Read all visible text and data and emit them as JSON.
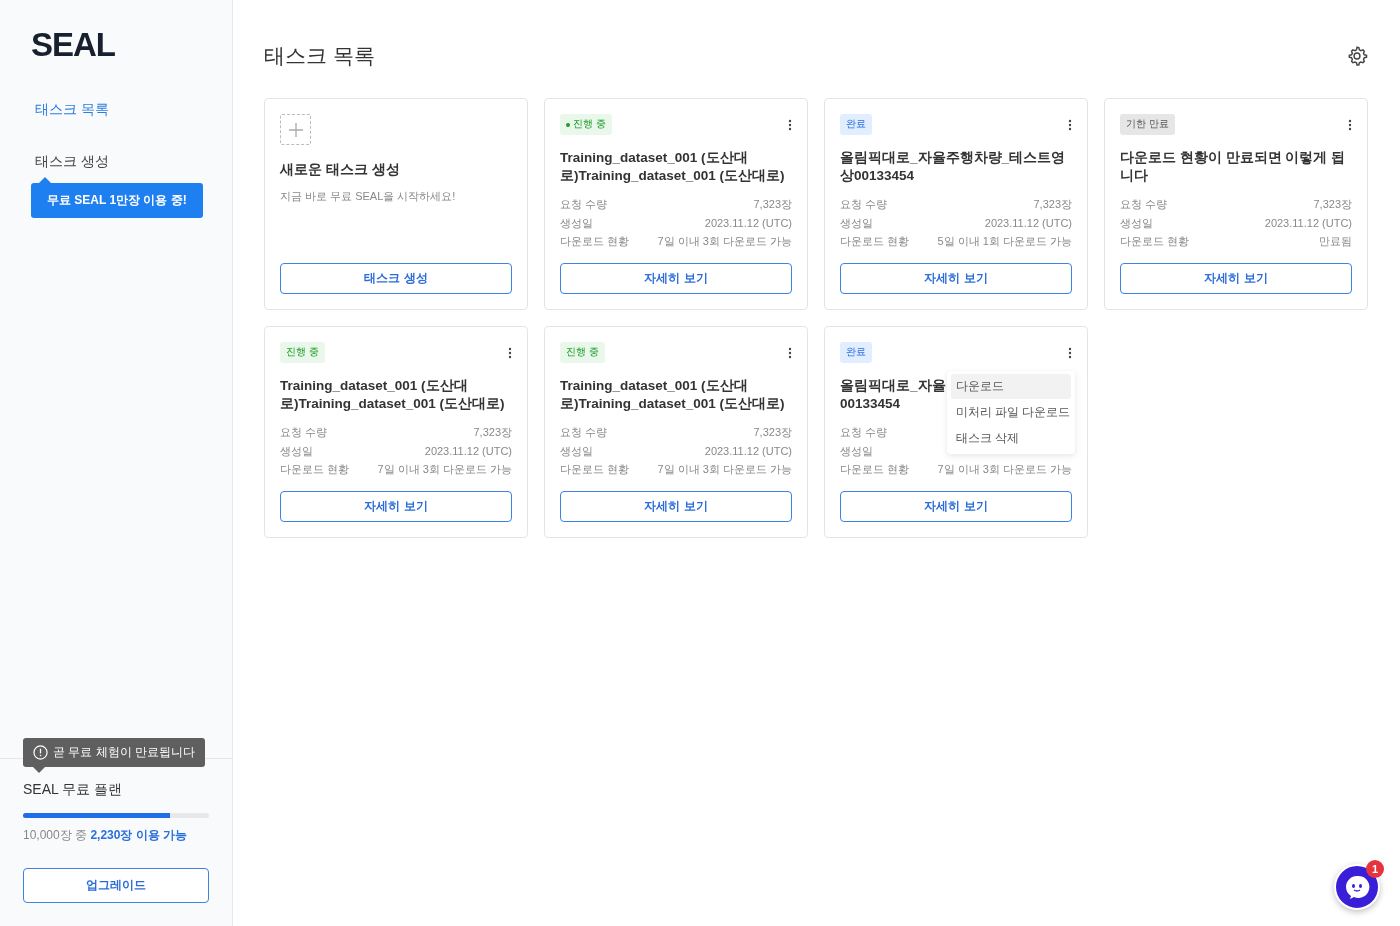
{
  "sidebar": {
    "logo": "SEAL",
    "items": [
      {
        "label": "태스크 목록",
        "selected": true
      },
      {
        "label": "태스크 생성",
        "selected": false
      }
    ],
    "promo": "무료 SEAL 1만장 이용 중!",
    "warning": "곧 무료 체험이 만료됩니다",
    "plan": {
      "title": "SEAL 무료 플랜",
      "level": 0.79,
      "usage": "10,000장 중 **2,230장 이용 가능**",
      "button": "업그레이드"
    }
  },
  "page": {
    "title": "태스크 목록"
  },
  "new_card": {
    "title": "새로운 태스크 생성",
    "subtitle": "지금 바로 무료 SEAL을 시작하세요!",
    "button": "태스크 생성"
  },
  "cards": [
    {
      "status": "진행 중",
      "kind": "progress",
      "dot": true,
      "title": "Training_dataset_001 (도산대로)Training_dataset_001 (도산대로)",
      "rows": [
        {
          "label": "요청 수량",
          "value": "7,323장"
        },
        {
          "label": "생성일",
          "value": "2023.11.12 (UTC)"
        },
        {
          "label": "다운로드 현황",
          "value": "7일 이내 3회 다운로드 가능"
        }
      ],
      "button": "자세히 보기"
    },
    {
      "status": "완료",
      "kind": "done",
      "dot": false,
      "title": "올림픽대로_자율주행차량_테스트영상00133454",
      "rows": [
        {
          "label": "요청 수량",
          "value": "7,323장"
        },
        {
          "label": "생성일",
          "value": "2023.11.12 (UTC)"
        },
        {
          "label": "다운로드 현황",
          "value": "5일 이내 1회 다운로드 가능"
        }
      ],
      "button": "자세히 보기"
    },
    {
      "status": "기한 만료",
      "kind": "expired",
      "dot": false,
      "title": "다운로드 현황이 만료되면 이렇게 됩니다",
      "rows": [
        {
          "label": "요청 수량",
          "value": "7,323장"
        },
        {
          "label": "생성일",
          "value": "2023.11.12 (UTC)"
        },
        {
          "label": "다운로드 현황",
          "value": "만료됨"
        }
      ],
      "button": "자세히 보기"
    },
    {
      "status": "진행 중",
      "kind": "progress",
      "dot": false,
      "title": "Training_dataset_001 (도산대로)Training_dataset_001 (도산대로)",
      "rows": [
        {
          "label": "요청 수량",
          "value": "7,323장"
        },
        {
          "label": "생성일",
          "value": "2023.11.12 (UTC)"
        },
        {
          "label": "다운로드 현황",
          "value": "7일 이내 3회 다운로드 가능"
        }
      ],
      "button": "자세히 보기"
    },
    {
      "status": "진행 중",
      "kind": "progress",
      "dot": false,
      "title": "Training_dataset_001 (도산대로)Training_dataset_001 (도산대로)",
      "rows": [
        {
          "label": "요청 수량",
          "value": "7,323장"
        },
        {
          "label": "생성일",
          "value": "2023.11.12 (UTC)"
        },
        {
          "label": "다운로드 현황",
          "value": "7일 이내 3회 다운로드 가능"
        }
      ],
      "button": "자세히 보기"
    },
    {
      "status": "완료",
      "kind": "done",
      "dot": false,
      "title": "올림픽대로_자율\n00133454",
      "rows": [
        {
          "label": "요청 수량"
        },
        {
          "label": "생성일"
        },
        {
          "label": "다운로드 현황",
          "value": "7일 이내 3회 다운로드 가능"
        }
      ],
      "button": "자세히 보기",
      "menu": [
        {
          "label": "다운로드",
          "selected": true
        },
        {
          "label": "미처리 파일 다운로드",
          "selected": false
        },
        {
          "label": "태스크 삭제",
          "selected": false
        }
      ]
    }
  ],
  "chat": {
    "badge": "1"
  }
}
